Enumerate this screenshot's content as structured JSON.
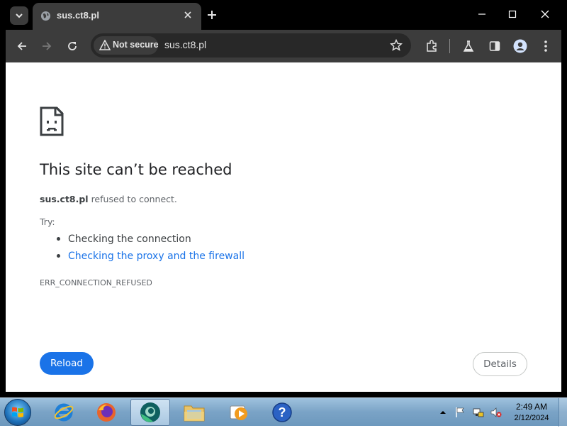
{
  "browser": {
    "tab": {
      "title": "sus.ct8.pl"
    },
    "toolbar": {
      "security_chip": "Not secure",
      "url": "sus.ct8.pl"
    }
  },
  "error_page": {
    "headline": "This site can’t be reached",
    "host": "sus.ct8.pl",
    "refused_text": " refused to connect.",
    "try_label": "Try:",
    "suggestions": [
      {
        "text": "Checking the connection",
        "is_link": false
      },
      {
        "text": "Checking the proxy and the firewall",
        "is_link": true
      }
    ],
    "error_code": "ERR_CONNECTION_REFUSED",
    "reload_label": "Reload",
    "details_label": "Details"
  },
  "taskbar": {
    "apps": [
      {
        "name": "internet-explorer-icon",
        "active": false
      },
      {
        "name": "firefox-icon",
        "active": false
      },
      {
        "name": "chrome-icon",
        "active": true
      },
      {
        "name": "file-explorer-icon",
        "active": false
      },
      {
        "name": "media-player-icon",
        "active": false
      },
      {
        "name": "help-icon",
        "active": false
      }
    ],
    "clock": {
      "time": "2:49 AM",
      "date": "2/12/2024"
    }
  },
  "colors": {
    "accent": "#1a73e8",
    "chrome_dark": "#3c3c3c",
    "tab_strip": "#000000"
  }
}
